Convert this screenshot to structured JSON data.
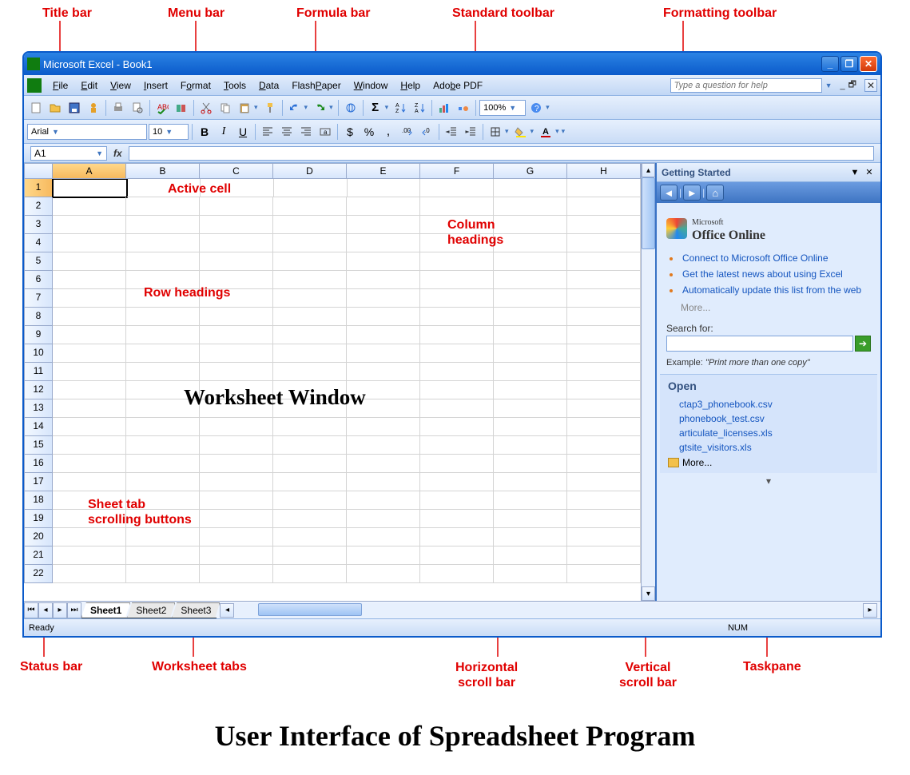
{
  "annotations": {
    "title_bar": "Title bar",
    "menu_bar": "Menu bar",
    "formula_bar": "Formula bar",
    "standard_toolbar": "Standard toolbar",
    "formatting_toolbar": "Formatting toolbar",
    "active_cell": "Active cell",
    "column_headings": "Column headings",
    "row_headings": "Row headings",
    "worksheet_window": "Worksheet Window",
    "sheet_tab_scrolling": "Sheet tab scrolling buttons",
    "status_bar": "Status bar",
    "worksheet_tabs": "Worksheet tabs",
    "horizontal_scroll": "Horizontal scroll bar",
    "vertical_scroll": "Vertical scroll bar",
    "taskpane": "Taskpane"
  },
  "window": {
    "title": "Microsoft Excel - Book1"
  },
  "menu": {
    "items": [
      "File",
      "Edit",
      "View",
      "Insert",
      "Format",
      "Tools",
      "Data",
      "FlashPaper",
      "Window",
      "Help",
      "Adobe PDF"
    ],
    "help_placeholder": "Type a question for help"
  },
  "toolbar": {
    "font_name": "Arial",
    "font_size": "10",
    "zoom": "100%",
    "bold": "B",
    "italic": "I",
    "underline": "U",
    "currency": "$",
    "percent": "%",
    "comma": ","
  },
  "formula": {
    "name_box": "A1",
    "fx": "fx"
  },
  "grid": {
    "columns": [
      "A",
      "B",
      "C",
      "D",
      "E",
      "F",
      "G",
      "H"
    ],
    "rows": [
      "1",
      "2",
      "3",
      "4",
      "5",
      "6",
      "7",
      "8",
      "9",
      "10",
      "11",
      "12",
      "13",
      "14",
      "15",
      "16",
      "17",
      "18",
      "19",
      "20",
      "21",
      "22"
    ]
  },
  "sheets": {
    "tabs": [
      "Sheet1",
      "Sheet2",
      "Sheet3"
    ],
    "active": "Sheet1"
  },
  "taskpane": {
    "title": "Getting Started",
    "office_label": "Office Online",
    "brand_prefix": "Microsoft",
    "links": [
      "Connect to Microsoft Office Online",
      "Get the latest news about using Excel",
      "Automatically update this list from the web"
    ],
    "more": "More...",
    "search_label": "Search for:",
    "example_label": "Example:",
    "example_text": "\"Print more than one copy\"",
    "open_title": "Open",
    "recent_files": [
      "ctap3_phonebook.csv",
      "phonebook_test.csv",
      "articulate_licenses.xls",
      "gtsite_visitors.xls"
    ],
    "open_more": "More..."
  },
  "status": {
    "ready": "Ready",
    "num": "NUM"
  },
  "caption": "User Interface of Spreadsheet Program"
}
